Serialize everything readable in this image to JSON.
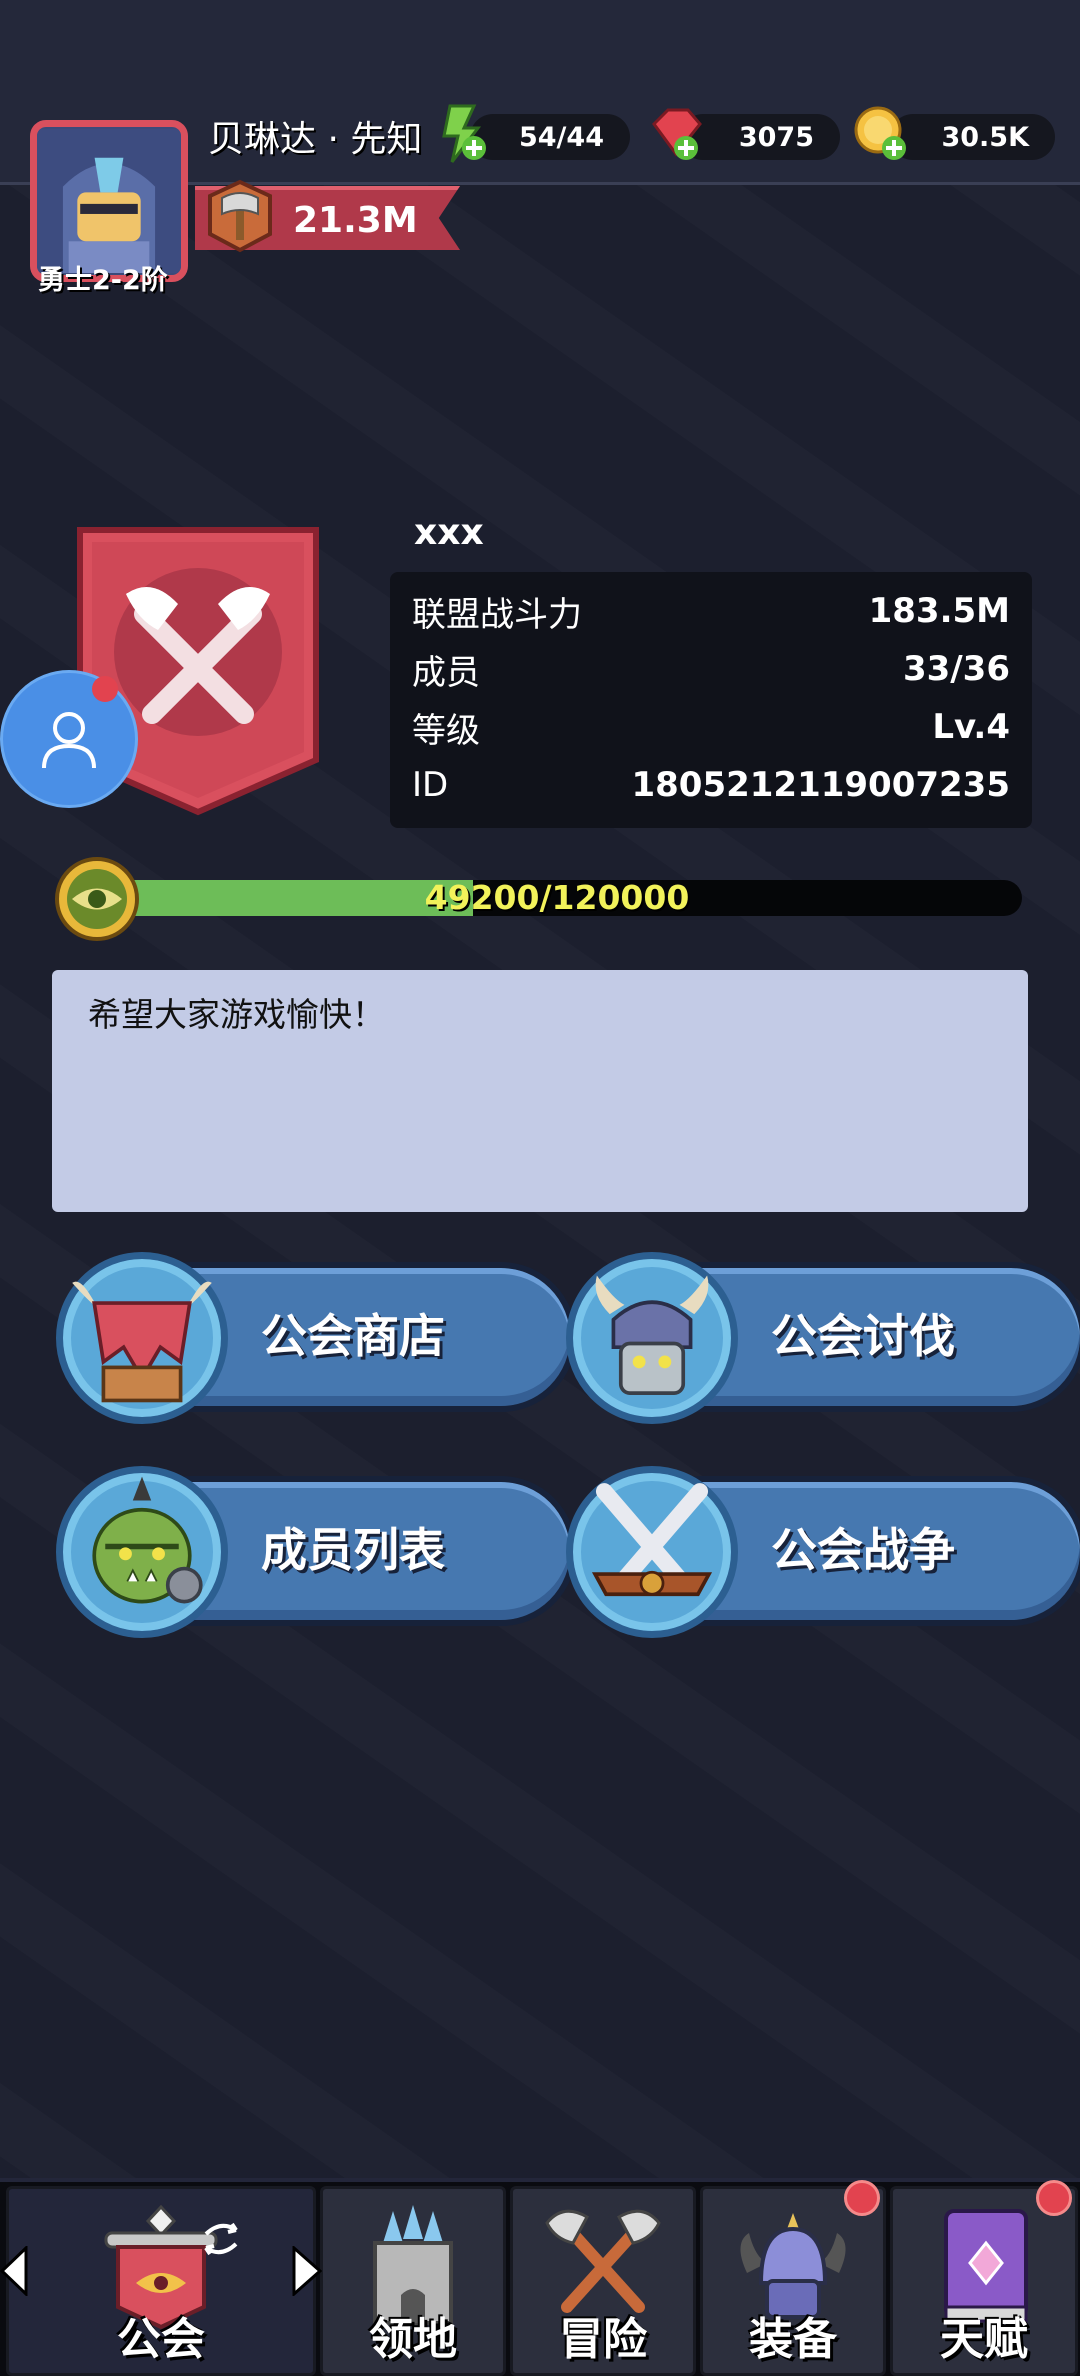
{
  "player": {
    "name": "贝琳达 · 先知",
    "rank": "勇士2-2阶",
    "power": "21.3M"
  },
  "resources": {
    "energy": "54/44",
    "gems": "3075",
    "gold": "30.5K"
  },
  "guild": {
    "name": "xxx",
    "stats": [
      {
        "label": "联盟战斗力",
        "value": "183.5M"
      },
      {
        "label": "成员",
        "value": "33/36"
      },
      {
        "label": "等级",
        "value": "Lv.4"
      },
      {
        "label": "ID",
        "value": "1805212119007235"
      }
    ],
    "xp_text": "49200/120000",
    "xp_fraction": 0.41,
    "notice": "希望大家游戏愉快！"
  },
  "menu": {
    "shop": "公会商店",
    "raid": "公会讨伐",
    "members": "成员列表",
    "war": "公会战争"
  },
  "nav": {
    "guild": "公会",
    "territory": "领地",
    "adventure": "冒险",
    "equipment": "装备",
    "talent": "天赋"
  },
  "colors": {
    "accent_red": "#d9505e",
    "button_blue": "#4678b0",
    "xp_green": "#6dbd58",
    "badge_red": "#e2434f"
  }
}
